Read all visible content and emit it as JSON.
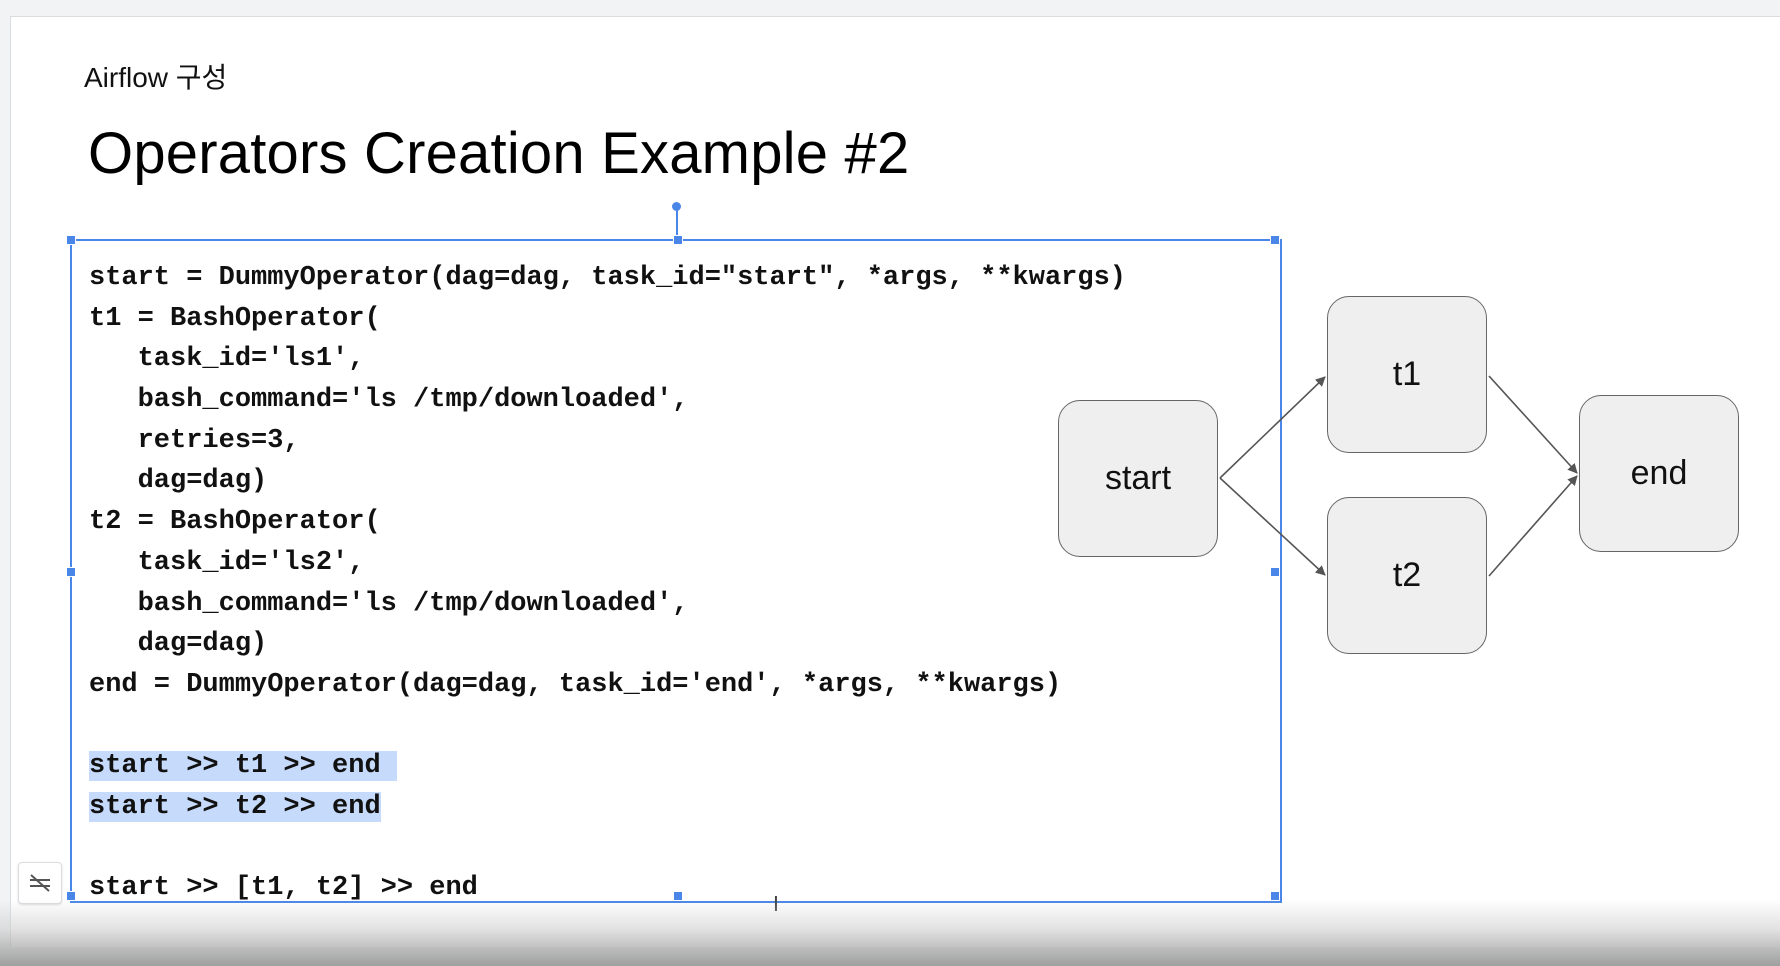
{
  "slide": {
    "subtitle": "Airflow 구성",
    "title": "Operators Creation Example #2"
  },
  "code": {
    "lines": [
      {
        "text": "start = DummyOperator(dag=dag, task_id=\"start\", *args, **kwargs)",
        "highlighted": false
      },
      {
        "text": "t1 = BashOperator(",
        "highlighted": false
      },
      {
        "text": "   task_id='ls1',",
        "highlighted": false
      },
      {
        "text": "   bash_command='ls /tmp/downloaded',",
        "highlighted": false
      },
      {
        "text": "   retries=3,",
        "highlighted": false
      },
      {
        "text": "   dag=dag)",
        "highlighted": false
      },
      {
        "text": "t2 = BashOperator(",
        "highlighted": false
      },
      {
        "text": "   task_id='ls2',",
        "highlighted": false
      },
      {
        "text": "   bash_command='ls /tmp/downloaded',",
        "highlighted": false
      },
      {
        "text": "   dag=dag)",
        "highlighted": false
      },
      {
        "text": "end = DummyOperator(dag=dag, task_id='end', *args, **kwargs)",
        "highlighted": false
      },
      {
        "text": "",
        "highlighted": false
      },
      {
        "text": "start >> t1 >> end ",
        "highlighted": true
      },
      {
        "text": "start >> t2 >> end",
        "highlighted": true
      },
      {
        "text": "",
        "highlighted": false
      },
      {
        "text": "start >> [t1, t2] >> end",
        "highlighted": false
      }
    ]
  },
  "diagram": {
    "nodes": {
      "start": "start",
      "t1": "t1",
      "t2": "t2",
      "end": "end"
    }
  },
  "colors": {
    "selection": "#4a86e8",
    "highlight": "#c6dafc",
    "node_fill": "#efefef",
    "node_border": "#666666"
  },
  "icons": {
    "side_button": "hide-comments-icon",
    "cursor": "text-cursor-icon"
  }
}
